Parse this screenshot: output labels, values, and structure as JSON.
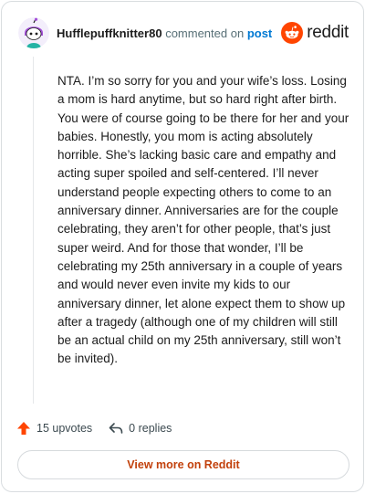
{
  "header": {
    "username": "Hufflepuffknitter80",
    "action_text": "commented on",
    "target_link": "post",
    "brand_name": "reddit"
  },
  "comment": {
    "text": "NTA. I’m so sorry for you and your wife’s loss. Losing a mom is hard anytime, but so hard right after birth. You were of course going to be there for her and your babies. Honestly, you mom is acting absolutely horrible. She’s lacking basic care and empathy and acting super spoiled and self-centered. I’ll never understand people expecting others to come to an anniversary dinner. Anniversaries are for the couple celebrating, they aren’t for other people, that’s just super weird. And for those that wonder, I’ll be celebrating my 25th anniversary in a couple of years and would never even invite my kids to our anniversary dinner, let alone expect them to show up after a tragedy (although one of my children will still be an actual child on my 25th anniversary, still won’t be invited)."
  },
  "footer": {
    "upvotes": "15 upvotes",
    "replies": "0 replies",
    "view_more": "View more on Reddit"
  },
  "icons": {
    "avatar": "snoo-avatar-icon",
    "brand": "reddit-logo-icon",
    "upvote": "upvote-arrow-icon",
    "reply": "reply-arrow-icon"
  },
  "colors": {
    "reddit_orange": "#ff4500",
    "link_blue": "#0079d3",
    "view_more_text": "#c2410c",
    "avatar_purple": "#a34fd8",
    "avatar_teal": "#24b3a4"
  }
}
